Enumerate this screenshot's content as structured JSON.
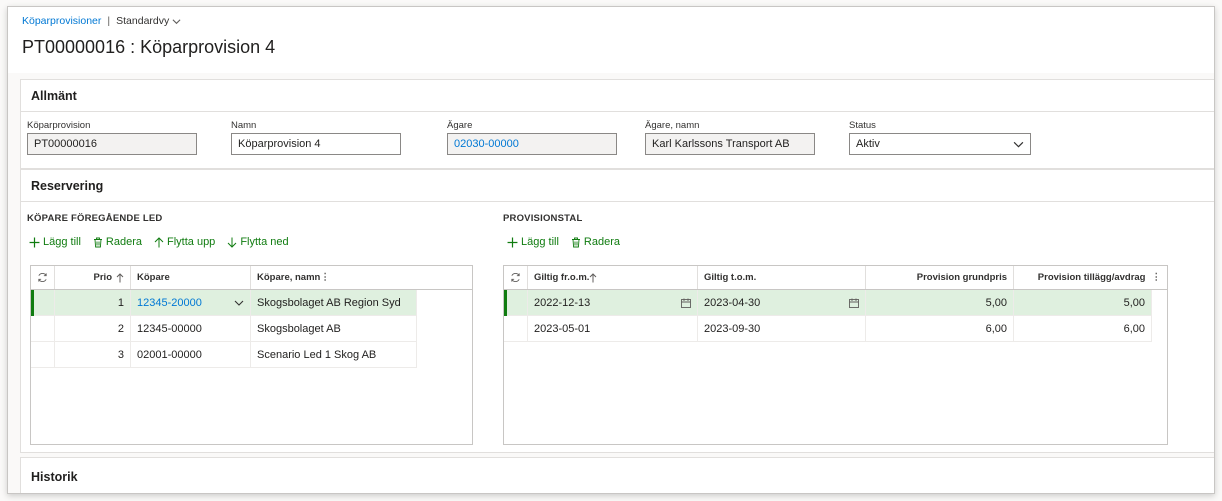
{
  "breadcrumb": {
    "link": "Köparprovisioner",
    "separator": "|",
    "view": "Standardvy"
  },
  "page_title": "PT00000016 : Köparprovision 4",
  "tabs": {
    "general": "Allmänt",
    "reservation": "Reservering",
    "history": "Historik"
  },
  "fields": {
    "kop_label": "Köparprovision",
    "kop_value": "PT00000016",
    "namn_label": "Namn",
    "namn_value": "Köparprovision 4",
    "agare_label": "Ägare",
    "agare_value": "02030-00000",
    "agare_namn_label": "Ägare, namn",
    "agare_namn_value": "Karl Karlssons Transport AB",
    "status_label": "Status",
    "status_value": "Aktiv"
  },
  "buyers": {
    "title": "KÖPARE FÖREGÅENDE LED",
    "actions": {
      "add": "Lägg till",
      "delete": "Radera",
      "up": "Flytta upp",
      "down": "Flytta ned"
    },
    "columns": {
      "prio": "Prio",
      "kopare": "Köpare",
      "namn": "Köpare, namn"
    },
    "rows": [
      {
        "prio": "1",
        "kopare": "12345-20000",
        "namn": "Skogsbolaget AB Region Syd"
      },
      {
        "prio": "2",
        "kopare": "12345-00000",
        "namn": "Skogsbolaget AB"
      },
      {
        "prio": "3",
        "kopare": "02001-00000",
        "namn": "Scenario Led 1 Skog AB"
      }
    ]
  },
  "provisions": {
    "title": "PROVISIONSTAL",
    "actions": {
      "add": "Lägg till",
      "delete": "Radera"
    },
    "columns": {
      "from": "Giltig fr.o.m.",
      "to": "Giltig t.o.m.",
      "base": "Provision grundpris",
      "extra": "Provision tillägg/avdrag"
    },
    "rows": [
      {
        "from": "2022-12-13",
        "to": "2023-04-30",
        "base": "5,00",
        "extra": "5,00"
      },
      {
        "from": "2023-05-01",
        "to": "2023-09-30",
        "base": "6,00",
        "extra": "6,00"
      }
    ]
  },
  "colors": {
    "link": "#0078d4",
    "action": "#107c10",
    "selected_row": "#dff0df"
  }
}
